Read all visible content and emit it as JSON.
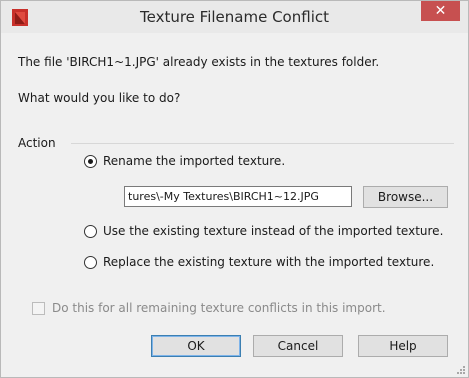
{
  "window": {
    "title": "Texture Filename Conflict",
    "close_glyph": "✕",
    "app_icon": "chief-architect-logo-icon",
    "colors": {
      "close_button": "#c75050",
      "app_icon_red": "#c8302a"
    }
  },
  "message": {
    "line1": "The file 'BIRCH1~1.JPG' already exists in the textures folder.",
    "line2": "What would you like to do?"
  },
  "action_group": {
    "label": "Action",
    "options": [
      {
        "label": "Rename the imported texture.",
        "selected": true
      },
      {
        "label": "Use the existing texture instead of the imported texture.",
        "selected": false
      },
      {
        "label": "Replace the existing texture with the imported texture.",
        "selected": false
      }
    ],
    "rename_path_value": "tures\\-My Textures\\BIRCH1~12.JPG",
    "browse_label": "Browse..."
  },
  "apply_all": {
    "label": "Do this for all remaining texture conflicts in this import.",
    "checked": false,
    "enabled": false
  },
  "buttons": {
    "ok": "OK",
    "cancel": "Cancel",
    "help": "Help"
  }
}
